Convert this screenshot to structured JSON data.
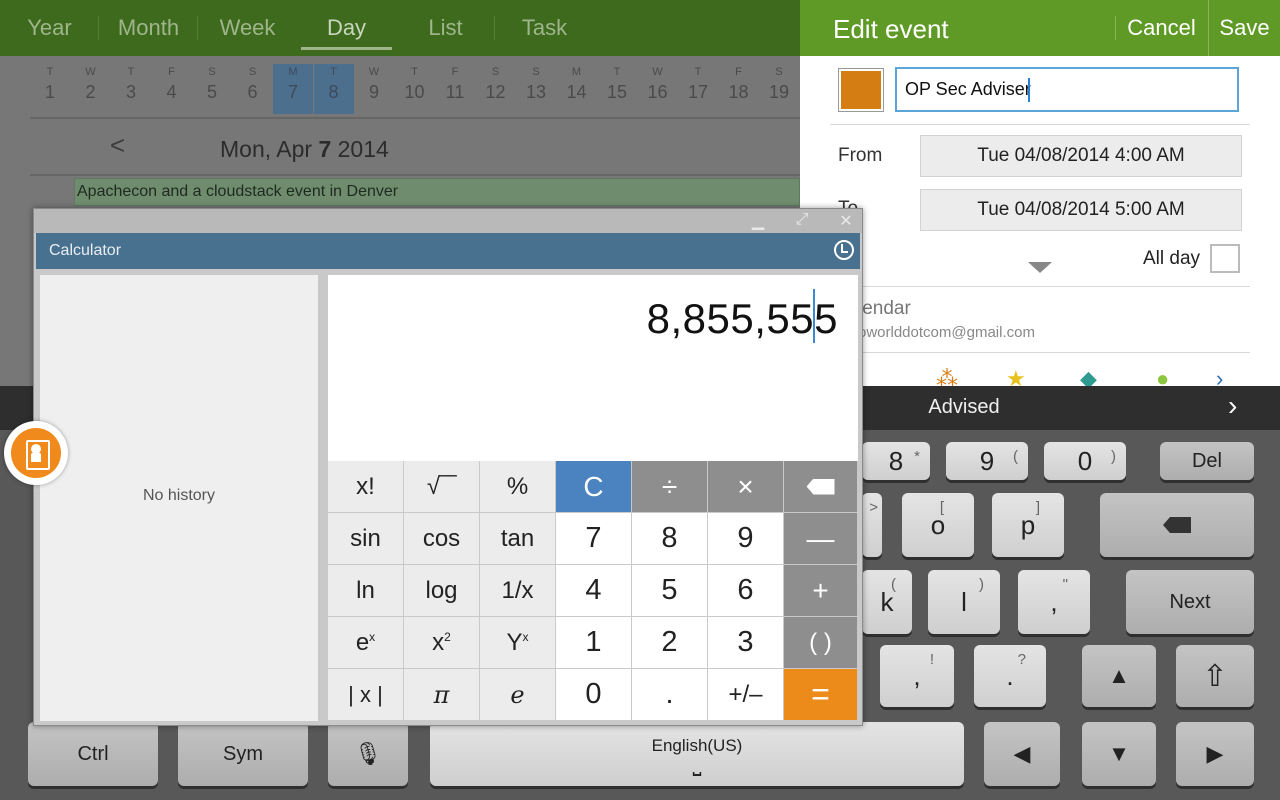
{
  "calendar": {
    "tabs": [
      "Year",
      "Month",
      "Week",
      "Day",
      "List",
      "Task"
    ],
    "active_tab": "Day",
    "week_strip": [
      {
        "l": "T",
        "n": "1"
      },
      {
        "l": "W",
        "n": "2"
      },
      {
        "l": "T",
        "n": "3"
      },
      {
        "l": "F",
        "n": "4"
      },
      {
        "l": "S",
        "n": "5"
      },
      {
        "l": "S",
        "n": "6"
      },
      {
        "l": "M",
        "n": "7"
      },
      {
        "l": "T",
        "n": "8"
      },
      {
        "l": "W",
        "n": "9"
      },
      {
        "l": "T",
        "n": "10"
      },
      {
        "l": "F",
        "n": "11"
      },
      {
        "l": "S",
        "n": "12"
      },
      {
        "l": "S",
        "n": "13"
      },
      {
        "l": "M",
        "n": "14"
      },
      {
        "l": "T",
        "n": "15"
      },
      {
        "l": "W",
        "n": "16"
      },
      {
        "l": "T",
        "n": "17"
      },
      {
        "l": "F",
        "n": "18"
      },
      {
        "l": "S",
        "n": "19"
      }
    ],
    "selected_days": [
      "7",
      "8"
    ],
    "prev_glyph": "<",
    "date_weekday_month": "Mon, Apr ",
    "date_day": "7",
    "date_year": " 2014",
    "event_title": "Apachecon and a cloudstack event in Denver"
  },
  "edit_event": {
    "title": "Edit event",
    "cancel": "Cancel",
    "save": "Save",
    "color": "#d47d12",
    "title_value": "OP Sec Adviser",
    "from_label": "From",
    "to_label": "To",
    "from_value": "Tue 04/08/2014  4:00  AM",
    "to_value": "Tue 04/08/2014  5:00  AM",
    "all_day_label": "All day",
    "calendar_label": "Calendar",
    "calendar_label_visible": "lendar",
    "calendar_account_visible": "oworlddotcom@gmail.com"
  },
  "calculator": {
    "title": "Calculator",
    "history_empty": "No history",
    "display": "8,855,555",
    "keys": {
      "fact": "x!",
      "sqrt": "√‾‾",
      "percent": "%",
      "clear": "C",
      "divide": "÷",
      "multiply": "×",
      "backspace": "⌫",
      "sin": "sin",
      "cos": "cos",
      "tan": "tan",
      "n7": "7",
      "n8": "8",
      "n9": "9",
      "minus": "—",
      "ln": "ln",
      "log": "log",
      "recip": "1/x",
      "n4": "4",
      "n5": "5",
      "n6": "6",
      "plus": "+",
      "exp_base": "e",
      "exp_sup": "x",
      "sq_base": "x",
      "sq_sup": "2",
      "pow_base": "Y",
      "pow_sup": "x",
      "n1": "1",
      "n2": "2",
      "n3": "3",
      "paren": "( )",
      "abs": "| x |",
      "pi": "π",
      "e": "e",
      "n0": "0",
      "dot": ".",
      "sign": "+/–",
      "equals": "="
    }
  },
  "keyboard": {
    "suggestion": "Advised",
    "suggest_more": "›",
    "row1": [
      {
        "k": "8",
        "s": "*"
      },
      {
        "k": "9",
        "s": "("
      },
      {
        "k": "0",
        "s": ")"
      }
    ],
    "del": "Del",
    "row2": [
      {
        "k": "o",
        "s": "["
      },
      {
        "k": "p",
        "s": "]"
      }
    ],
    "row2_partial_sub": ">",
    "row3": [
      {
        "k": "k",
        "s": "("
      },
      {
        "k": "l",
        "s": ")"
      },
      {
        "k": ",",
        "s": "\""
      }
    ],
    "next": "Next",
    "row4": [
      {
        "k": ",",
        "s": "!"
      },
      {
        "k": ".",
        "s": "?"
      }
    ],
    "ctrl": "Ctrl",
    "sym": "Sym",
    "space_label": "English(US)",
    "space_glyph": "⎵",
    "mic_glyph": "🎙",
    "arrows": {
      "up": "▲",
      "down": "▼",
      "left": "◀",
      "right": "▶",
      "shift": "⇧"
    }
  }
}
